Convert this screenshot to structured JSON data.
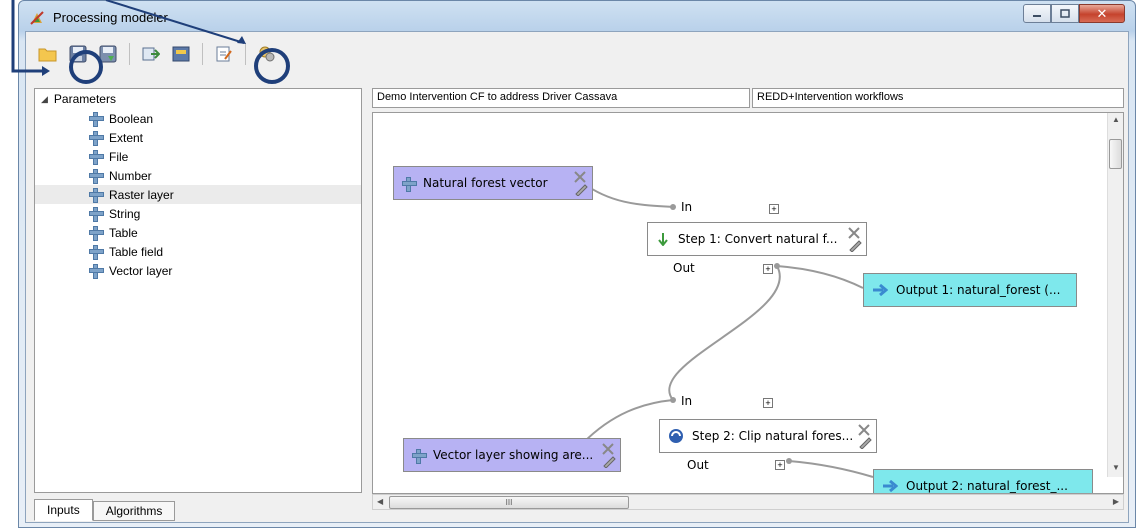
{
  "window": {
    "title": "Processing modeler"
  },
  "toolbar": {
    "buttons": [
      {
        "name": "open-model-button",
        "icon": "folder-icon"
      },
      {
        "name": "save-button",
        "icon": "save-icon"
      },
      {
        "name": "save-as-button",
        "icon": "save-as-icon"
      },
      {
        "name": "export-image-button",
        "icon": "export-image-icon"
      },
      {
        "name": "export-python-button",
        "icon": "export-python-icon"
      },
      {
        "name": "edit-help-button",
        "icon": "edit-help-icon"
      },
      {
        "name": "run-model-button",
        "icon": "run-icon"
      }
    ]
  },
  "inputs_panel": {
    "root_label": "Parameters",
    "items": [
      "Boolean",
      "Extent",
      "File",
      "Number",
      "Raster layer",
      "String",
      "Table",
      "Table field",
      "Vector layer"
    ],
    "selected": "Raster layer"
  },
  "tabs": [
    "Inputs",
    "Algorithms"
  ],
  "model": {
    "name": "Demo Intervention CF to address Driver Cassava",
    "group": "REDD+Intervention workflows"
  },
  "canvas": {
    "nodes": {
      "param1": "Natural forest vector",
      "step1": "Step 1: Convert natural f...",
      "out1": "Output 1: natural_forest (...",
      "param2": "Vector layer showing are...",
      "step2": "Step 2: Clip natural fores...",
      "out2": "Output 2: natural_forest_..."
    },
    "ports": {
      "in": "In",
      "out": "Out"
    }
  },
  "scroll": {
    "thumb_label": "III"
  },
  "colors": {
    "param_node": "#b7b2f3",
    "output_node": "#7ee8ec",
    "annotation": "#1f3f7a"
  }
}
